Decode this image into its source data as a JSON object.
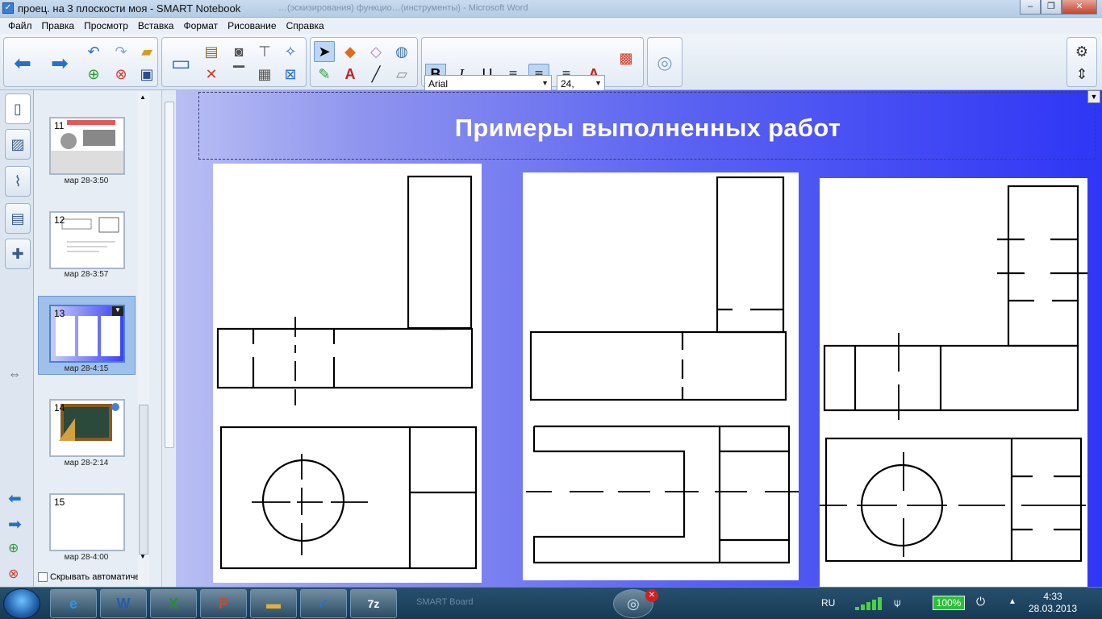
{
  "window": {
    "title": "проец. на 3 плоскости моя - SMART Notebook",
    "background_title": "…(эскизирования) функцио…(инструменты) - Microsoft Word",
    "controls": {
      "minimize": "‒",
      "maximize": "❐",
      "close": "✕"
    }
  },
  "menu": [
    "Файл",
    "Правка",
    "Просмотр",
    "Вставка",
    "Формат",
    "Рисование",
    "Справка"
  ],
  "toolbar": {
    "font_family": "Arial",
    "font_size": "24,",
    "buttons": {
      "back": "back-arrow-icon",
      "forward": "forward-arrow-icon",
      "undo": "undo-icon",
      "redo": "redo-icon",
      "add_page": "add-page-icon",
      "delete_page": "delete-page-icon",
      "open": "open-folder-icon",
      "save": "save-icon",
      "screen": "display-screen-icon",
      "paste": "paste-icon",
      "delete": "delete-icon",
      "capture": "screen-capture-icon",
      "screen_shade": "screen-shade-icon",
      "table": "table-icon",
      "window_capture": "window-capture-icon",
      "select": "select-arrow-icon",
      "shapes": "shapes-icon",
      "eraser": "eraser-icon",
      "fill": "fill-icon",
      "pens": "pens-icon",
      "text": "text-icon",
      "line": "line-icon",
      "magic_pen": "magic-pen-icon",
      "bold": "B",
      "italic": "I",
      "underline": "U",
      "align_left": "align-left-icon",
      "align_center": "align-center-icon",
      "align_right": "align-right-icon",
      "text_style": "text-style-icon",
      "properties": "color-palette-icon",
      "transparency": "transparency-icon",
      "settings": "gear-icon",
      "move_toolbar": "move-vertical-icon"
    }
  },
  "sidebar_tabs": [
    "page-sorter-icon",
    "gallery-icon",
    "attachments-icon",
    "properties-icon",
    "addons-icon"
  ],
  "pages": [
    {
      "number": "11",
      "date": "мар 28-3:50"
    },
    {
      "number": "12",
      "date": "мар 28-3:57"
    },
    {
      "number": "13",
      "date": "мар 28-4:15"
    },
    {
      "number": "14",
      "date": "мар 28-2:14"
    },
    {
      "number": "15",
      "date": "мар 28-4:00"
    }
  ],
  "selected_page": "13",
  "autohide_label": "Скрывать автоматическ",
  "slide": {
    "title": "Примеры выполненных работ"
  },
  "taskbar": {
    "apps": [
      "internet-explorer-icon",
      "word-icon",
      "excel-icon",
      "powerpoint-icon",
      "explorer-folder-icon",
      "notebook-icon",
      "7zip-icon"
    ],
    "ghost_app": "SMART Board",
    "language": "RU",
    "battery": "100%",
    "time": "4:33",
    "date": "28.03.2013"
  }
}
